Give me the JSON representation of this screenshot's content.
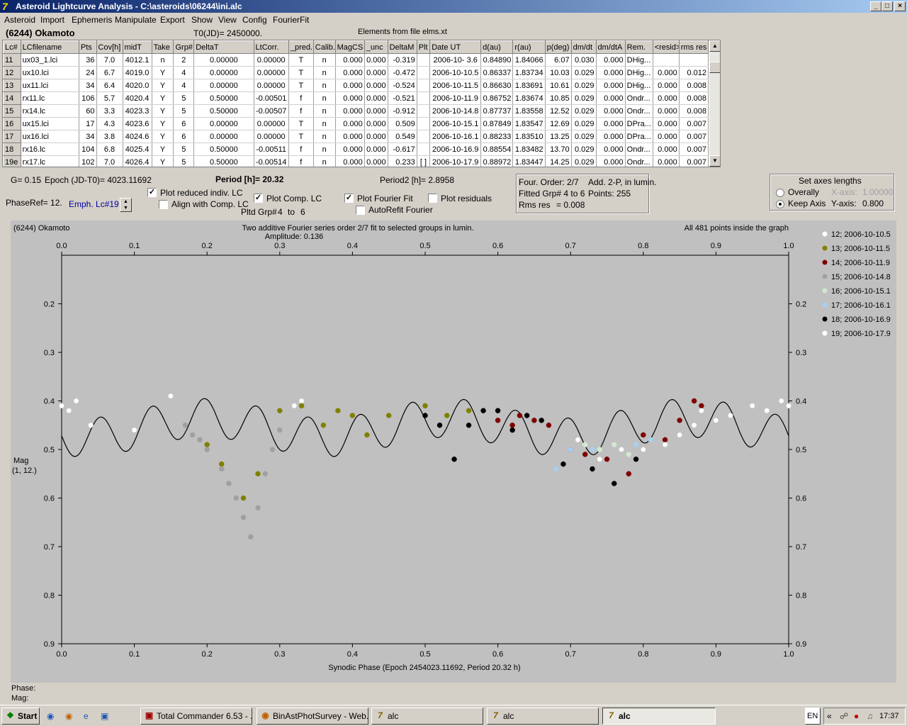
{
  "title": "Asteroid Lightcurve Analysis - C:\\asteroids\\06244\\ini.alc",
  "menu": [
    "Asteroid",
    "Import",
    "Ephemeris",
    "Manipulate",
    "Export",
    "Show",
    "View",
    "Config",
    "FourierFit"
  ],
  "asteroid_name": "(6244) Okamoto",
  "t0": "T0(JD)= 2450000.",
  "elements_note": "Elements from file elms.xt",
  "table": {
    "headers": [
      "Lc#",
      "LCfilename",
      "Pts",
      "Cov[h]",
      "midT",
      "Take",
      "Grp#",
      "DeltaT",
      "LtCorr.",
      "_pred.",
      "Calib.",
      "MagCS",
      "_unc",
      "DeltaM",
      "Plt",
      "Date UT",
      "d(au)",
      "r(au)",
      "p(deg)",
      "dm/dt",
      "dm/dtA",
      "Rem.",
      "<resid>",
      "rms res"
    ],
    "rows": [
      [
        "11",
        "ux03_1.lci",
        "36",
        "7.0",
        "4012.1",
        "n",
        "2",
        "0.00000",
        "0.00000",
        "T",
        "n",
        "0.000",
        "0.000",
        "-0.319",
        "",
        "2006-10- 3.6",
        "0.84890",
        "1.84066",
        "6.07",
        "0.030",
        "0.000",
        "DHig...",
        "",
        ""
      ],
      [
        "12",
        "ux10.lci",
        "24",
        "6.7",
        "4019.0",
        "Y",
        "4",
        "0.00000",
        "0.00000",
        "T",
        "n",
        "0.000",
        "0.000",
        "-0.472",
        "",
        "2006-10-10.5",
        "0.86337",
        "1.83734",
        "10.03",
        "0.029",
        "0.000",
        "DHig...",
        "0.000",
        "0.012"
      ],
      [
        "13",
        "ux11.lci",
        "34",
        "6.4",
        "4020.0",
        "Y",
        "4",
        "0.00000",
        "0.00000",
        "T",
        "n",
        "0.000",
        "0.000",
        "-0.524",
        "",
        "2006-10-11.5",
        "0.86630",
        "1.83691",
        "10.61",
        "0.029",
        "0.000",
        "DHig...",
        "0.000",
        "0.008"
      ],
      [
        "14",
        "rx11.lc",
        "106",
        "5.7",
        "4020.4",
        "Y",
        "5",
        "0.50000",
        "-0.00501",
        "f",
        "n",
        "0.000",
        "0.000",
        "-0.521",
        "",
        "2006-10-11.9",
        "0.86752",
        "1.83674",
        "10.85",
        "0.029",
        "0.000",
        "Ondr...",
        "0.000",
        "0.008"
      ],
      [
        "15",
        "rx14.lc",
        "60",
        "3.3",
        "4023.3",
        "Y",
        "5",
        "0.50000",
        "-0.00507",
        "f",
        "n",
        "0.000",
        "0.000",
        "-0.912",
        "",
        "2006-10-14.8",
        "0.87737",
        "1.83558",
        "12.52",
        "0.029",
        "0.000",
        "Ondr...",
        "0.000",
        "0.008"
      ],
      [
        "16",
        "ux15.lci",
        "17",
        "4.3",
        "4023.6",
        "Y",
        "6",
        "0.00000",
        "0.00000",
        "T",
        "n",
        "0.000",
        "0.000",
        "0.509",
        "",
        "2006-10-15.1",
        "0.87849",
        "1.83547",
        "12.69",
        "0.029",
        "0.000",
        "DPra...",
        "0.000",
        "0.007"
      ],
      [
        "17",
        "ux16.lci",
        "34",
        "3.8",
        "4024.6",
        "Y",
        "6",
        "0.00000",
        "0.00000",
        "T",
        "n",
        "0.000",
        "0.000",
        "0.549",
        "",
        "2006-10-16.1",
        "0.88233",
        "1.83510",
        "13.25",
        "0.029",
        "0.000",
        "DPra...",
        "0.000",
        "0.007"
      ],
      [
        "18",
        "rx16.lc",
        "104",
        "6.8",
        "4025.4",
        "Y",
        "5",
        "0.50000",
        "-0.00511",
        "f",
        "n",
        "0.000",
        "0.000",
        "-0.617",
        "",
        "2006-10-16.9",
        "0.88554",
        "1.83482",
        "13.70",
        "0.029",
        "0.000",
        "Ondr...",
        "0.000",
        "0.007"
      ],
      [
        "19e",
        "rx17.lc",
        "102",
        "7.0",
        "4026.4",
        "Y",
        "5",
        "0.50000",
        "-0.00514",
        "f",
        "n",
        "0.000",
        "0.000",
        "0.233",
        "[ ]",
        "2006-10-17.9",
        "0.88972",
        "1.83447",
        "14.25",
        "0.029",
        "0.000",
        "Ondr...",
        "0.000",
        "0.007"
      ]
    ]
  },
  "params": {
    "g": "G= 0.15",
    "epoch": "Epoch (JD-T0)= 4023.11692",
    "period": "Period [h]= 20.32",
    "period2": "Period2 [h]= 2.8958",
    "phaseref": "PhaseRef= 12.",
    "emph": "Emph. Lc#19:",
    "pltd_grp": "Pltd Grp#",
    "grp_from": "4",
    "grp_to_label": "to",
    "grp_to": "6"
  },
  "checkboxes": {
    "plot_reduced": {
      "label": "Plot reduced indiv. LC",
      "checked": true
    },
    "align_comp": {
      "label": "Align with Comp. LC",
      "checked": false
    },
    "plot_comp": {
      "label": "Plot Comp. LC",
      "checked": true
    },
    "plot_fourier": {
      "label": "Plot Fourier Fit",
      "checked": true
    },
    "plot_residuals": {
      "label": "Plot residuals",
      "checked": false
    },
    "autorefit": {
      "label": "AutoRefit Fourier",
      "checked": false
    }
  },
  "fourier_box": {
    "order": "Four. Order:  2/7",
    "add": "Add. 2-P, in lumin.",
    "fitted": "Fitted Grp# 4 to 6",
    "points": "Points: 255",
    "rms_label": "Rms res",
    "rms_value": "= 0.008"
  },
  "axes_box": {
    "title": "Set axes lengths",
    "overall": "Overally",
    "keep": "Keep Axis",
    "x_label": "X-axis:",
    "x_value": "1.00000",
    "y_label": "Y-axis:",
    "y_value": "0.800",
    "selected": "keep"
  },
  "graph": {
    "title_left": "(6244) Okamoto",
    "title_center": "Two additive Fourier series order 2/7 fit to selected groups in lumin.",
    "amplitude": "Amplitude: 0.136",
    "title_right": "All 481 points inside the graph",
    "ylabel": "Mag",
    "ylabel2": "(1, 12.)",
    "xlabel": "Synodic Phase (Epoch 2454023.11692, Period 20.32 h)",
    "phase_label": "Phase:",
    "mag_label": "Mag:",
    "background": "#c0c0c0"
  },
  "chart_data": {
    "type": "scatter",
    "xlim": [
      0.0,
      1.0
    ],
    "ylim": [
      0.9,
      0.1
    ],
    "x_ticks": [
      "0.0",
      "0.1",
      "0.2",
      "0.3",
      "0.4",
      "0.5",
      "0.6",
      "0.7",
      "0.8",
      "0.9",
      "1.0"
    ],
    "y_ticks": [
      "0.2",
      "0.3",
      "0.4",
      "0.5",
      "0.6",
      "0.7",
      "0.8",
      "0.9"
    ],
    "legend": [
      {
        "label": "12; 2006-10-10.5",
        "color": "#ffffff"
      },
      {
        "label": "13; 2006-10-11.5",
        "color": "#808000"
      },
      {
        "label": "14; 2006-10-11.9",
        "color": "#800000"
      },
      {
        "label": "15; 2006-10-14.8",
        "color": "#a0a0a0"
      },
      {
        "label": "16; 2006-10-15.1",
        "color": "#d0e8d0"
      },
      {
        "label": "17; 2006-10-16.1",
        "color": "#a8d0f0"
      },
      {
        "label": "18; 2006-10-16.9",
        "color": "#000000"
      },
      {
        "label": "19; 2006-10-17.9",
        "color": "#ffffff"
      }
    ],
    "series": [
      {
        "color": "#ffffff",
        "points": [
          [
            0.0,
            0.41
          ],
          [
            0.01,
            0.42
          ],
          [
            0.02,
            0.4
          ],
          [
            0.04,
            0.45
          ],
          [
            0.1,
            0.46
          ],
          [
            0.15,
            0.39
          ],
          [
            0.32,
            0.41
          ],
          [
            0.33,
            0.4
          ],
          [
            0.9,
            0.44
          ],
          [
            0.92,
            0.43
          ],
          [
            0.95,
            0.41
          ],
          [
            0.97,
            0.42
          ],
          [
            0.99,
            0.4
          ],
          [
            1.0,
            0.41
          ]
        ]
      },
      {
        "color": "#808000",
        "points": [
          [
            0.2,
            0.49
          ],
          [
            0.22,
            0.53
          ],
          [
            0.25,
            0.6
          ],
          [
            0.27,
            0.55
          ],
          [
            0.3,
            0.42
          ],
          [
            0.33,
            0.41
          ],
          [
            0.36,
            0.45
          ],
          [
            0.38,
            0.42
          ],
          [
            0.4,
            0.43
          ],
          [
            0.42,
            0.47
          ],
          [
            0.45,
            0.43
          ],
          [
            0.5,
            0.41
          ],
          [
            0.53,
            0.43
          ],
          [
            0.56,
            0.42
          ]
        ]
      },
      {
        "color": "#800000",
        "points": [
          [
            0.6,
            0.44
          ],
          [
            0.62,
            0.45
          ],
          [
            0.63,
            0.43
          ],
          [
            0.65,
            0.44
          ],
          [
            0.67,
            0.45
          ],
          [
            0.7,
            0.5
          ],
          [
            0.72,
            0.51
          ],
          [
            0.75,
            0.52
          ],
          [
            0.78,
            0.55
          ],
          [
            0.8,
            0.47
          ],
          [
            0.83,
            0.48
          ],
          [
            0.85,
            0.44
          ],
          [
            0.87,
            0.4
          ],
          [
            0.88,
            0.41
          ]
        ]
      },
      {
        "color": "#a0a0a0",
        "points": [
          [
            0.17,
            0.45
          ],
          [
            0.18,
            0.47
          ],
          [
            0.19,
            0.48
          ],
          [
            0.2,
            0.5
          ],
          [
            0.22,
            0.54
          ],
          [
            0.23,
            0.57
          ],
          [
            0.24,
            0.6
          ],
          [
            0.25,
            0.64
          ],
          [
            0.26,
            0.68
          ],
          [
            0.27,
            0.62
          ],
          [
            0.28,
            0.55
          ],
          [
            0.29,
            0.5
          ],
          [
            0.3,
            0.46
          ]
        ]
      },
      {
        "color": "#d0e8d0",
        "points": [
          [
            0.72,
            0.49
          ],
          [
            0.74,
            0.5
          ],
          [
            0.76,
            0.49
          ],
          [
            0.78,
            0.51
          ]
        ]
      },
      {
        "color": "#a8d0f0",
        "points": [
          [
            0.68,
            0.54
          ],
          [
            0.7,
            0.5
          ],
          [
            0.73,
            0.5
          ],
          [
            0.77,
            0.5
          ],
          [
            0.79,
            0.49
          ],
          [
            0.81,
            0.48
          ]
        ]
      },
      {
        "color": "#000000",
        "points": [
          [
            0.5,
            0.43
          ],
          [
            0.52,
            0.45
          ],
          [
            0.54,
            0.52
          ],
          [
            0.56,
            0.45
          ],
          [
            0.58,
            0.42
          ],
          [
            0.6,
            0.42
          ],
          [
            0.62,
            0.46
          ],
          [
            0.64,
            0.43
          ],
          [
            0.66,
            0.44
          ],
          [
            0.69,
            0.53
          ],
          [
            0.73,
            0.54
          ],
          [
            0.76,
            0.57
          ],
          [
            0.79,
            0.52
          ]
        ]
      },
      {
        "color": "#ffffff",
        "points": [
          [
            0.71,
            0.48
          ],
          [
            0.74,
            0.52
          ],
          [
            0.77,
            0.5
          ],
          [
            0.8,
            0.5
          ],
          [
            0.83,
            0.49
          ],
          [
            0.85,
            0.47
          ],
          [
            0.87,
            0.45
          ],
          [
            0.88,
            0.42
          ]
        ]
      }
    ]
  },
  "taskbar": {
    "start": "Start",
    "items": [
      "Total Commander 6.53 - ...",
      "BinAstPhotSurvey - Web...",
      "alc",
      "alc",
      "alc"
    ],
    "active_index": 4,
    "lang": "EN",
    "clock": "17:37"
  }
}
